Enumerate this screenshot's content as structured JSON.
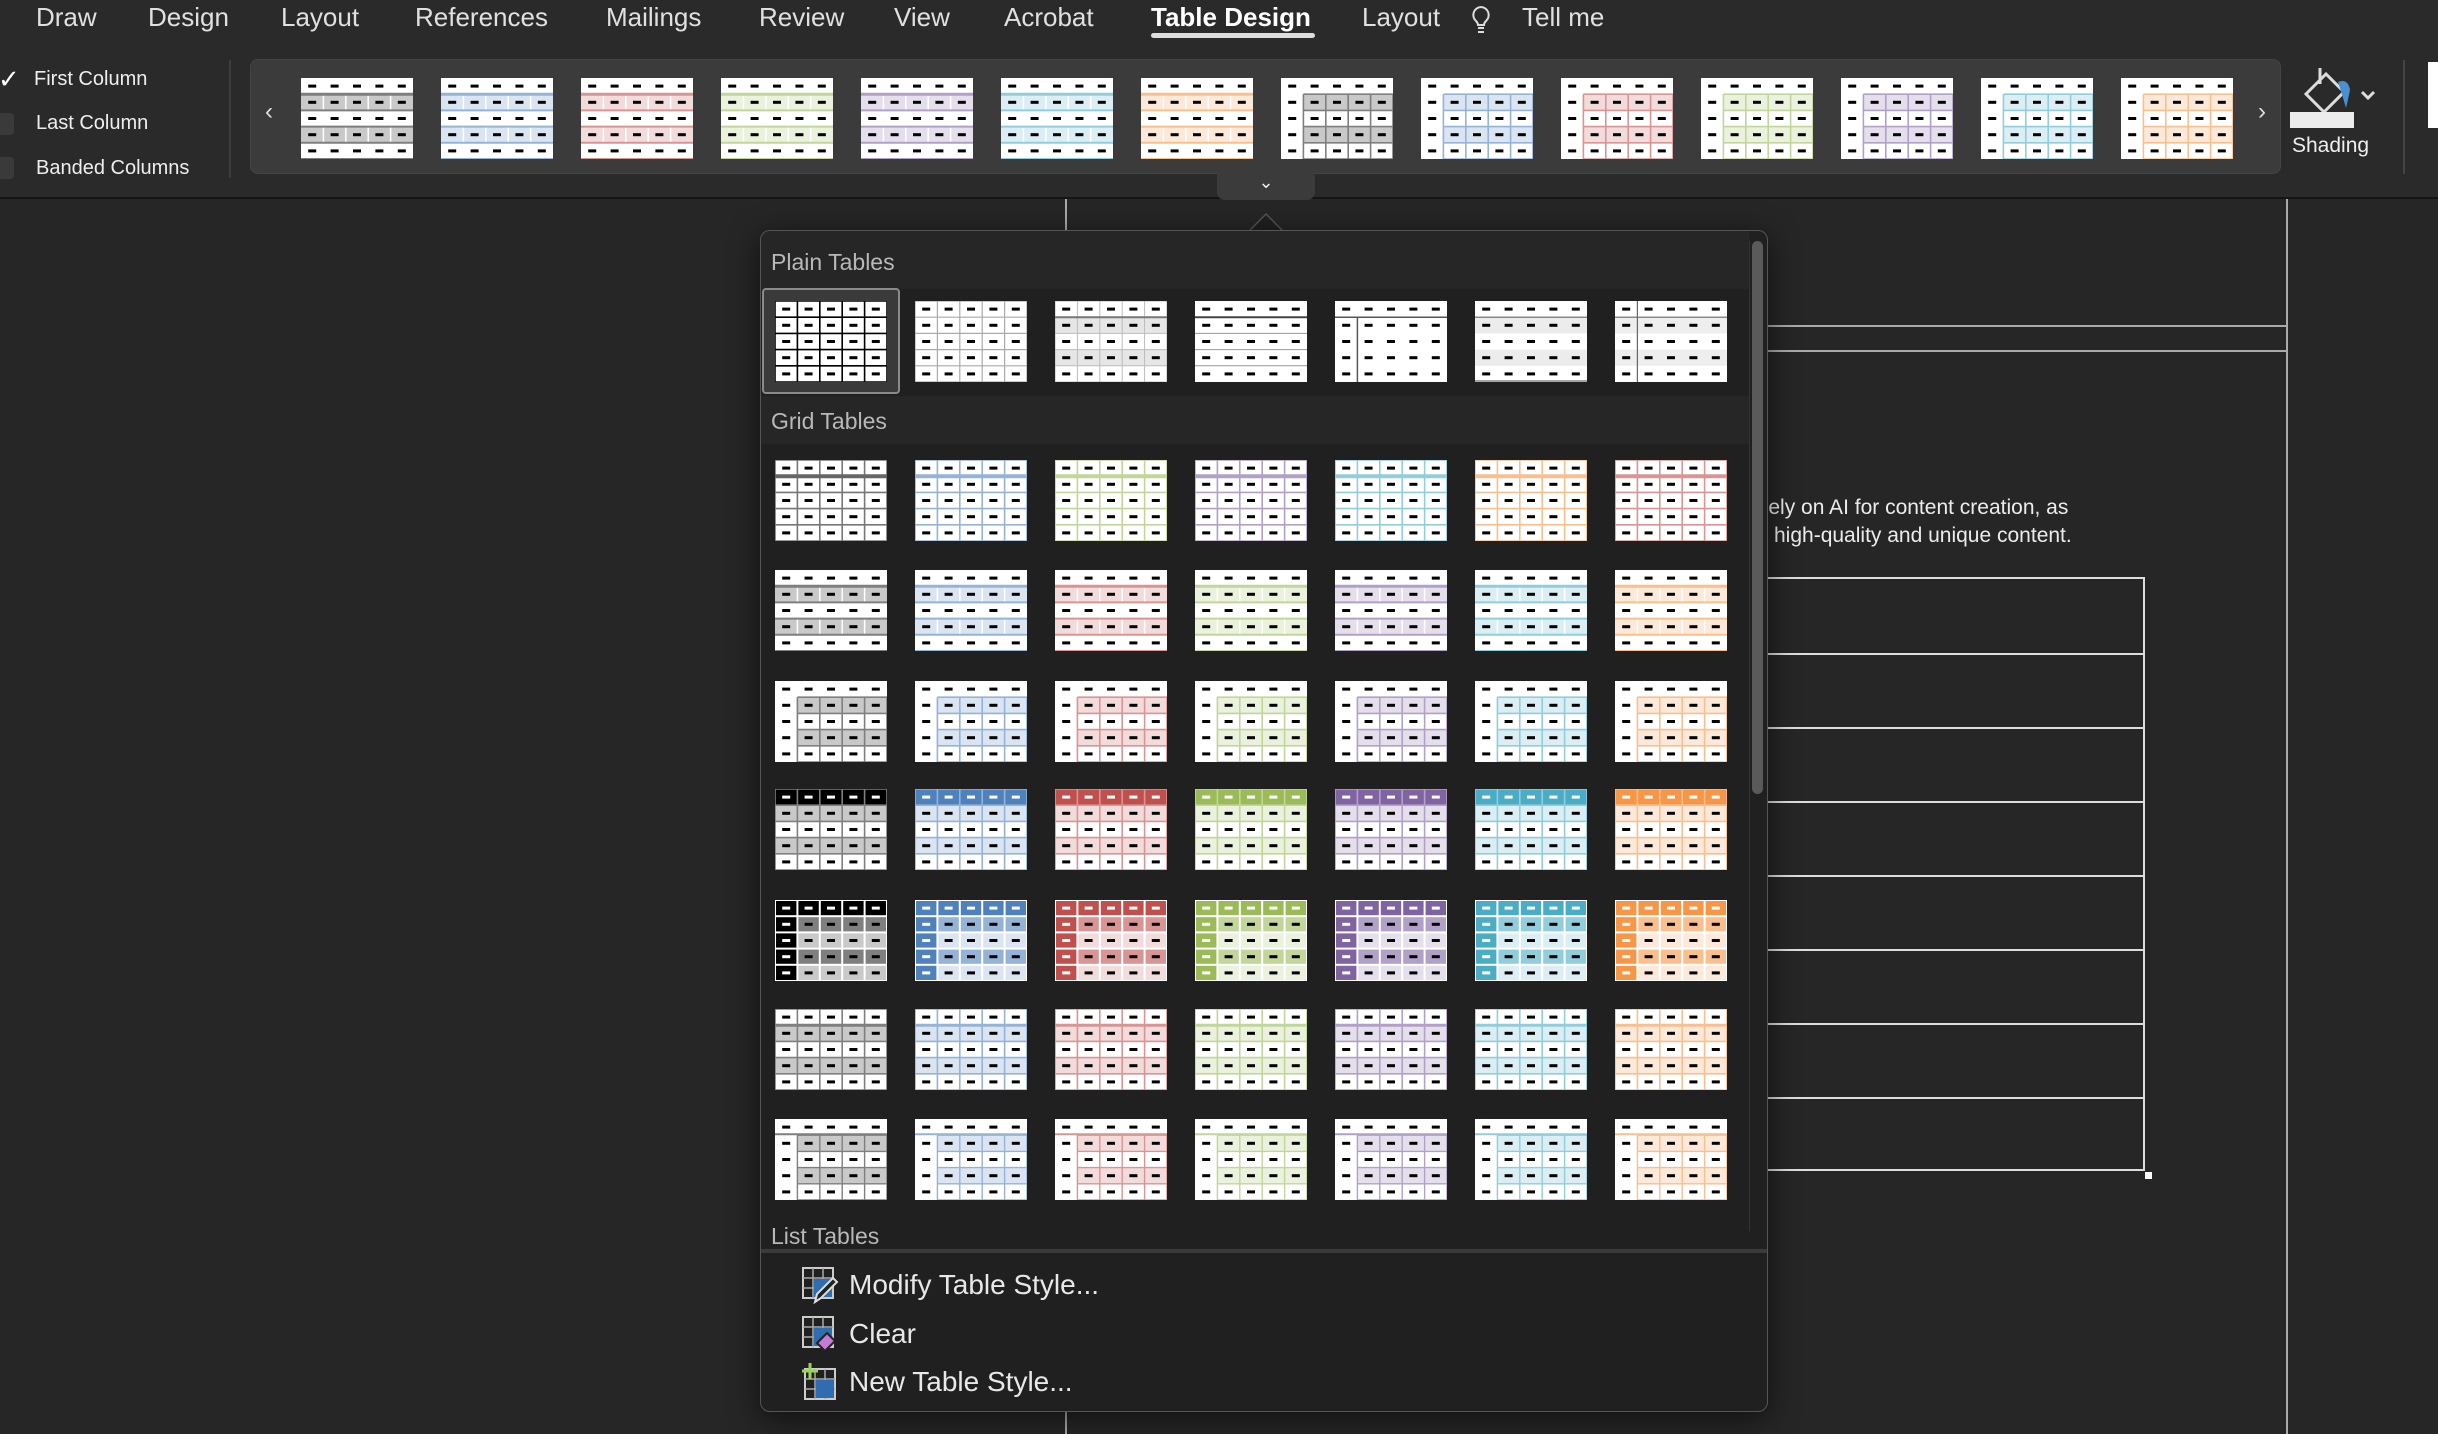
{
  "ribbon": {
    "tabs": [
      "Draw",
      "Design",
      "Layout",
      "References",
      "Mailings",
      "Review",
      "View",
      "Acrobat",
      "Table Design",
      "Layout"
    ],
    "active_tab": "Table Design",
    "tell_me": "Tell me",
    "options": [
      {
        "label": "First Column",
        "checked": true
      },
      {
        "label": "Last Column",
        "checked": false
      },
      {
        "label": "Banded Columns",
        "checked": false
      }
    ],
    "shading_label": "Shading",
    "shading_color": "#ececec"
  },
  "palette": {
    "gray": {
      "dark": "#000000",
      "med": "#7f7f7f",
      "light": "#c9c9c9"
    },
    "blue": {
      "dark": "#4f81bd",
      "med": "#95b3d7",
      "light": "#dbe5f1"
    },
    "red": {
      "dark": "#c0504d",
      "med": "#d99594",
      "light": "#f2dbdb"
    },
    "green": {
      "dark": "#9bbb59",
      "med": "#c2d69b",
      "light": "#eaf1dd"
    },
    "purple": {
      "dark": "#8064a2",
      "med": "#b2a1c7",
      "light": "#e5dfec"
    },
    "aqua": {
      "dark": "#4bacc6",
      "med": "#92cddc",
      "light": "#daeef3"
    },
    "orange": {
      "dark": "#f79646",
      "med": "#fabf8f",
      "light": "#fde9d9"
    }
  },
  "ribbon_gallery": [
    {
      "style": "grid2",
      "color": "gray"
    },
    {
      "style": "grid2",
      "color": "blue"
    },
    {
      "style": "grid2",
      "color": "red"
    },
    {
      "style": "grid2",
      "color": "green"
    },
    {
      "style": "grid2",
      "color": "purple"
    },
    {
      "style": "grid2",
      "color": "aqua"
    },
    {
      "style": "grid2",
      "color": "orange"
    },
    {
      "style": "grid3",
      "color": "gray"
    },
    {
      "style": "grid3",
      "color": "blue"
    },
    {
      "style": "grid3",
      "color": "red"
    },
    {
      "style": "grid3",
      "color": "green"
    },
    {
      "style": "grid3",
      "color": "purple"
    },
    {
      "style": "grid3",
      "color": "aqua"
    },
    {
      "style": "grid3",
      "color": "orange"
    }
  ],
  "dropdown": {
    "plain_title": "Plain Tables",
    "plain": [
      "plain1",
      "plain2",
      "plain3",
      "plain4",
      "plain5",
      "plain6",
      "plain7"
    ],
    "selected_plain": 0,
    "grid_title": "Grid Tables",
    "grid_rows": [
      {
        "style": "grid1",
        "colors": [
          "gray",
          "blue",
          "green",
          "purple",
          "aqua",
          "orange",
          "red"
        ]
      },
      {
        "style": "grid2",
        "colors": [
          "gray",
          "blue",
          "red",
          "green",
          "purple",
          "aqua",
          "orange"
        ]
      },
      {
        "style": "grid3",
        "colors": [
          "gray",
          "blue",
          "red",
          "green",
          "purple",
          "aqua",
          "orange"
        ]
      },
      {
        "style": "grid4",
        "colors": [
          "gray",
          "blue",
          "red",
          "green",
          "purple",
          "aqua",
          "orange"
        ]
      },
      {
        "style": "grid5",
        "colors": [
          "gray",
          "blue",
          "red",
          "green",
          "purple",
          "aqua",
          "orange"
        ]
      },
      {
        "style": "grid6",
        "colors": [
          "gray",
          "blue",
          "red",
          "green",
          "purple",
          "aqua",
          "orange"
        ]
      },
      {
        "style": "grid7",
        "colors": [
          "gray",
          "blue",
          "red",
          "green",
          "purple",
          "aqua",
          "orange"
        ]
      }
    ],
    "list_title": "List Tables",
    "menu": [
      {
        "label": "Modify Table Style...",
        "icon": "modify-table-style-icon"
      },
      {
        "label": "Clear",
        "icon": "clear-table-style-icon"
      },
      {
        "label": "New Table Style...",
        "icon": "new-table-style-icon"
      }
    ]
  },
  "document": {
    "lines": [
      "olely on AI for content creation, as",
      "high-quality and unique content."
    ]
  }
}
